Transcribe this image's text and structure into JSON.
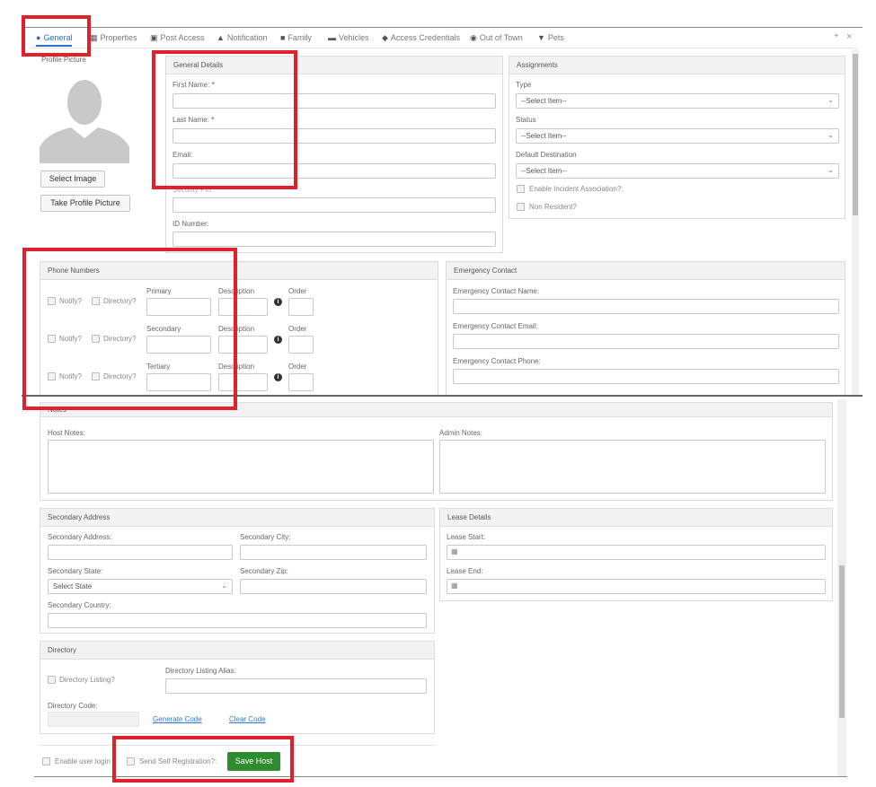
{
  "tabs": [
    {
      "label": "General",
      "icon": "user-icon",
      "active": true
    },
    {
      "label": "Properties",
      "icon": "building-icon"
    },
    {
      "label": "Post Access",
      "icon": "post-icon"
    },
    {
      "label": "Notification",
      "icon": "bell-icon"
    },
    {
      "label": "Family",
      "icon": "family-icon"
    },
    {
      "label": "Vehicles",
      "icon": "car-icon"
    },
    {
      "label": "Access Credentials",
      "icon": "key-icon"
    },
    {
      "label": "Out of Town",
      "icon": "globe-icon"
    },
    {
      "label": "Pets",
      "icon": "paw-icon"
    }
  ],
  "window_controls": {
    "expand": "+",
    "close": "×"
  },
  "profile": {
    "label": "Profile Picture",
    "select_image": "Select Image",
    "take_picture": "Take Profile Picture"
  },
  "general_details": {
    "title": "General Details",
    "first_name": "First Name:",
    "last_name": "Last Name:",
    "email": "Email:",
    "security_pin": "Security Pin:",
    "id_number": "ID Number:",
    "required_mark": "*"
  },
  "assignments": {
    "title": "Assignments",
    "type_label": "Type",
    "type_value": "--Select Item--",
    "status_label": "Status",
    "status_value": "--Select Item--",
    "destination_label": "Default Destination",
    "destination_value": "--Select Item--",
    "incident": "Enable Incident Association?:",
    "non_resident": "Non Resident?"
  },
  "phones": {
    "title": "Phone Numbers",
    "notify": "Notify?",
    "directory": "Directory?",
    "rows": [
      {
        "label": "Primary",
        "desc": "Description",
        "order": "Order"
      },
      {
        "label": "Secondary",
        "desc": "Description",
        "order": "Order"
      },
      {
        "label": "Tertiary",
        "desc": "Description",
        "order": "Order"
      }
    ],
    "info_glyph": "i"
  },
  "emergency": {
    "title": "Emergency Contact",
    "name": "Emergency Contact Name:",
    "email": "Emergency Contact Email:",
    "phone": "Emergency Contact Phone:"
  },
  "notes": {
    "title": "Notes",
    "host": "Host Notes:",
    "admin": "Admin Notes:"
  },
  "secondary": {
    "title": "Secondary Address",
    "address": "Secondary Address:",
    "city": "Secondary City:",
    "state": "Secondary State:",
    "state_value": "Select State",
    "zip": "Secondary Zip:",
    "country": "Secondary Country:"
  },
  "lease": {
    "title": "Lease Details",
    "start": "Lease Start:",
    "end": "Lease End:"
  },
  "directory": {
    "title": "Directory",
    "listing": "Directory Listing?",
    "alias": "Directory Listing Alias:",
    "code": "Directory Code:",
    "generate": "Generate Code",
    "clear": "Clear Code"
  },
  "footer": {
    "enable_login": "Enable user login",
    "self_reg": "Send Self Registration?:",
    "save": "Save Host"
  },
  "colors": {
    "highlight": "#e0202a",
    "save_button": "#2e8b2e",
    "active_tab": "#2a6fd1"
  }
}
